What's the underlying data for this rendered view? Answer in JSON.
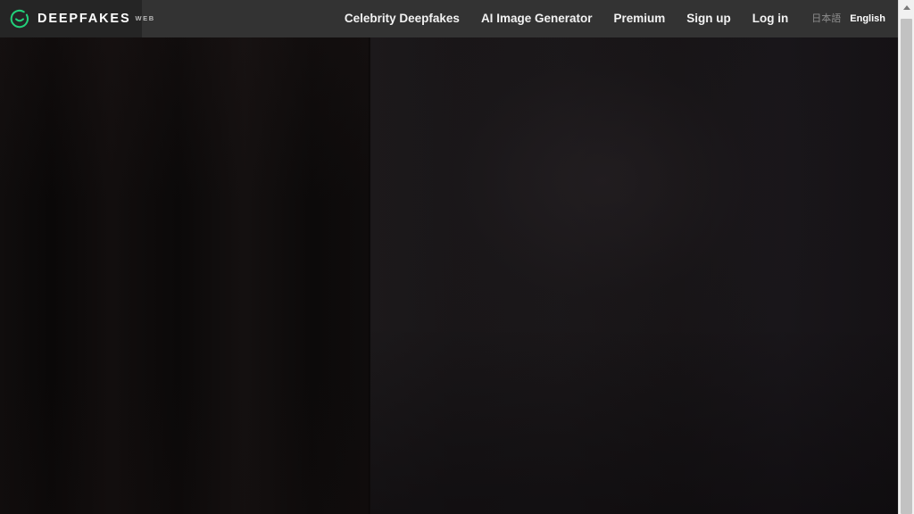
{
  "brand": {
    "logo_icon": "circle-smiley-icon",
    "name": "DEEPFAKES",
    "suffix": "WEB",
    "accent_color": "#22d07a"
  },
  "header": {
    "background_color": "#333333",
    "logo_panel_color": "#252525",
    "nav_links": [
      {
        "label": "Celebrity Deepfakes"
      },
      {
        "label": "AI Image Generator"
      },
      {
        "label": "Premium"
      },
      {
        "label": "Sign up"
      },
      {
        "label": "Log in"
      }
    ]
  },
  "language_switcher": {
    "options": [
      {
        "label": "日本語",
        "active": false
      },
      {
        "label": "English",
        "active": true
      }
    ]
  },
  "stage": {
    "left_panel_color": "#0b0909",
    "right_panel_color": "#171416"
  },
  "scrollbar": {
    "up_arrow_icon": "chevron-up-icon",
    "track_color": "#f1f1f1",
    "thumb_color": "#c2c2c2"
  }
}
